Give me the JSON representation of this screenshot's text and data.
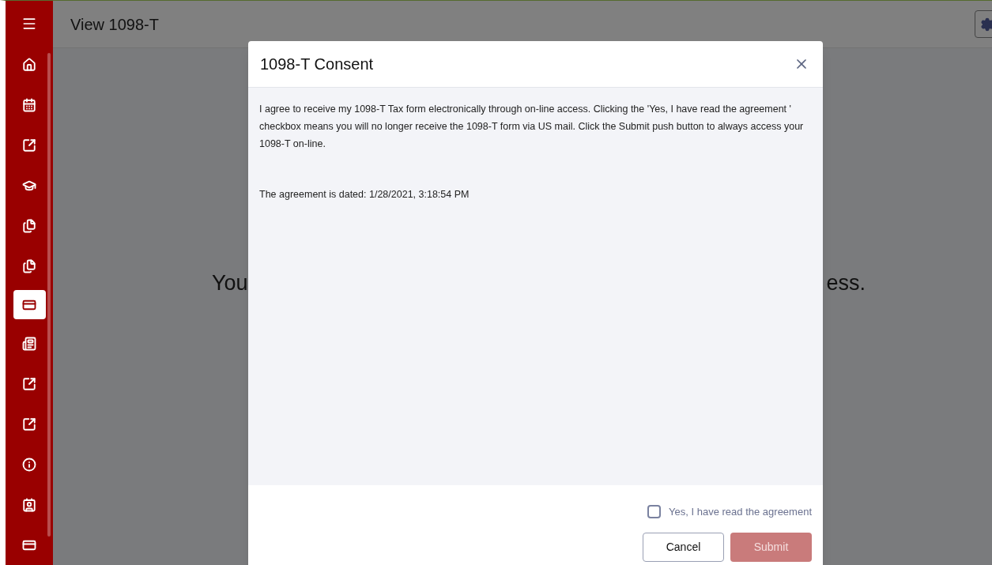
{
  "header": {
    "title": "View 1098-T"
  },
  "sidebar": {
    "items": [
      {
        "kind": "home",
        "selected": false
      },
      {
        "kind": "calendar",
        "selected": false
      },
      {
        "kind": "external",
        "selected": false
      },
      {
        "kind": "school",
        "selected": false
      },
      {
        "kind": "files",
        "selected": false
      },
      {
        "kind": "files",
        "selected": false
      },
      {
        "kind": "card",
        "selected": true
      },
      {
        "kind": "news",
        "selected": false
      },
      {
        "kind": "external",
        "selected": false
      },
      {
        "kind": "external",
        "selected": false
      },
      {
        "kind": "info",
        "selected": false
      },
      {
        "kind": "contact",
        "selected": false
      },
      {
        "kind": "card",
        "selected": false
      }
    ]
  },
  "background_message": {
    "left_part": "You",
    "right_part": "ess."
  },
  "dialog": {
    "title": "1098-T Consent",
    "body": [
      "I agree to receive my 1098-T Tax form electronically through on-line access. Clicking the 'Yes, I have read the agreement ' checkbox means you will no longer receive the 1098-T form via US mail. Click the Submit push button to always access your 1098-T on-line.",
      "The agreement is dated: 1/28/2021, 3:18:54 PM"
    ],
    "checkbox": {
      "label": "Yes, I have read the agreement",
      "checked": false
    },
    "buttons": [
      {
        "label": "Cancel",
        "kind": "secondary",
        "disabled": false
      },
      {
        "label": "Submit",
        "kind": "primary",
        "disabled": true
      }
    ]
  }
}
